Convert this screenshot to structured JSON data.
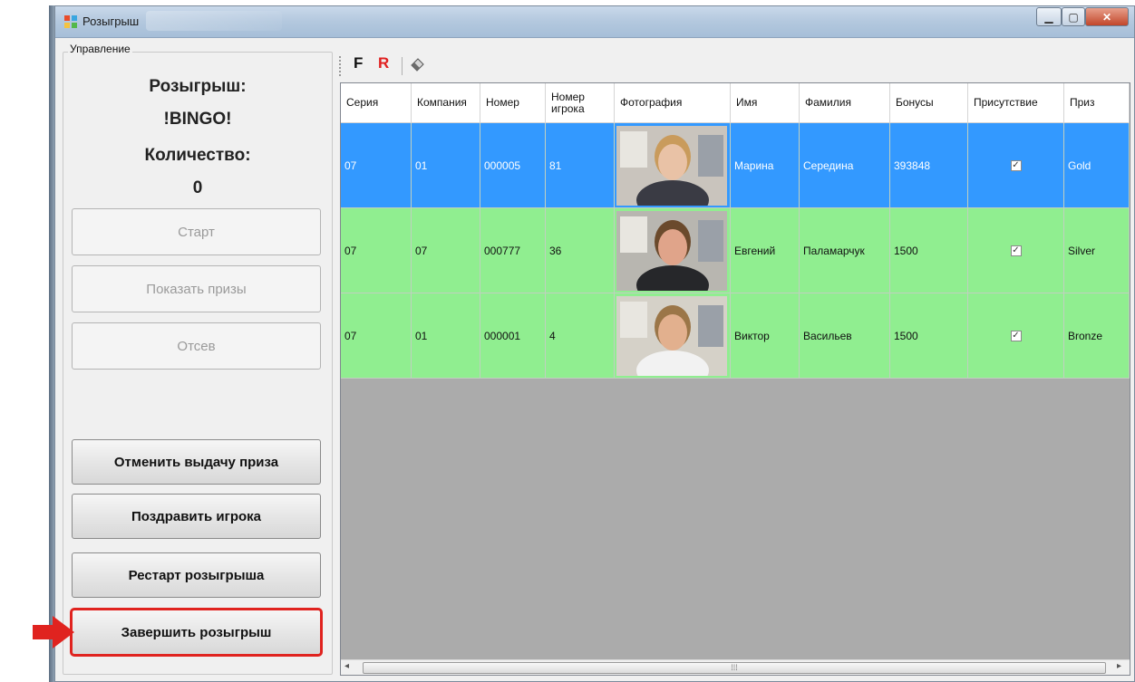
{
  "window": {
    "title": "Розыгрыш"
  },
  "left_panel": {
    "group_label": "Управление",
    "draw_title_label": "Розыгрыш:",
    "draw_name": "!BINGO!",
    "count_label": "Количество:",
    "count_value": "0",
    "buttons": {
      "start": "Старт",
      "show_prizes": "Показать призы",
      "screening": "Отсев",
      "cancel_prize": "Отменить выдачу приза",
      "congratulate": "Поздравить игрока",
      "restart": "Рестарт розыгрыша",
      "finish": "Завершить розыгрыш"
    }
  },
  "toolbar": {
    "f_label": "F",
    "r_label": "R",
    "eraser_icon": "eraser-icon"
  },
  "grid": {
    "columns": [
      "Серия",
      "Компания",
      "Номер",
      "Номер игрока",
      "Фотография",
      "Имя",
      "Фамилия",
      "Бонусы",
      "Присутствие",
      "Приз"
    ],
    "rows": [
      {
        "series": "07",
        "company": "01",
        "number": "000005",
        "player_number": "81",
        "first_name": "Марина",
        "last_name": "Середина",
        "bonus": "393848",
        "present": true,
        "prize": "Gold",
        "row_color": "#3399ff",
        "text_color": "#ffffff"
      },
      {
        "series": "07",
        "company": "07",
        "number": "000777",
        "player_number": "36",
        "first_name": "Евгений",
        "last_name": "Паламарчук",
        "bonus": "1500",
        "present": true,
        "prize": "Silver",
        "row_color": "#90ee90",
        "text_color": "#111111"
      },
      {
        "series": "07",
        "company": "01",
        "number": "000001",
        "player_number": "4",
        "first_name": "Виктор",
        "last_name": "Васильев",
        "bonus": "1500",
        "present": true,
        "prize": "Bronze",
        "row_color": "#90ee90",
        "text_color": "#111111"
      }
    ]
  },
  "colors": {
    "highlight": "#e0231f",
    "selected_row": "#3399ff",
    "row_green": "#90ee90",
    "grid_bg": "#ababab"
  }
}
